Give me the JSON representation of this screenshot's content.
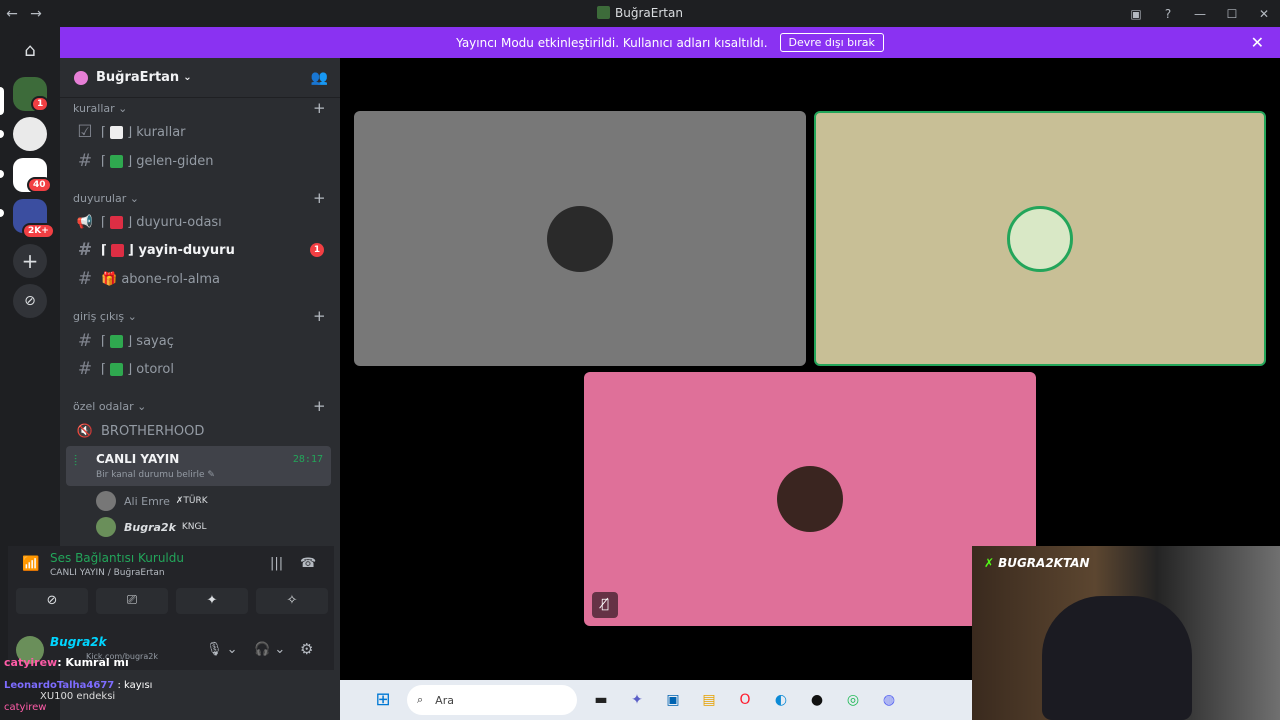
{
  "window": {
    "title": "BuğraErtan",
    "back": "←",
    "forward": "→",
    "controls": [
      "▣",
      "?",
      "—",
      "☐",
      "✕"
    ]
  },
  "banner": {
    "text": "Yayıncı Modu etkinleştirildi. Kullanıcı adları kısaltıldı.",
    "button": "Devre dışı bırak",
    "close": "✕"
  },
  "guilds": {
    "badges": [
      "1",
      "40",
      "2K+"
    ],
    "add": "+",
    "explore": "⊘"
  },
  "server": {
    "name": "BuğraErtan",
    "caret": "⌄",
    "invite_icon": "👥"
  },
  "categories": [
    {
      "name": "kurallar ⌄",
      "plus": "+"
    },
    {
      "name": "duyurular ⌄",
      "plus": "+"
    },
    {
      "name": "giriş çıkış ⌄",
      "plus": "+"
    },
    {
      "name": "özel odalar ⌄",
      "plus": "+"
    }
  ],
  "channels": [
    {
      "icon": "☑",
      "pre": "⌈",
      "post": "⌋",
      "name": "kurallar"
    },
    {
      "icon": "#",
      "pre": "⌈",
      "post": "⌋",
      "name": "gelen-giden"
    },
    {
      "icon": "📢",
      "pre": "⌈",
      "post": "⌋",
      "name": "duyuru-odası"
    },
    {
      "icon": "#",
      "pre": "⌈",
      "post": "⌋",
      "name": "yayin-duyuru",
      "unread": "1"
    },
    {
      "icon": "#",
      "pre": "",
      "post": "",
      "name": "🎁 abone-rol-alma"
    },
    {
      "icon": "#",
      "pre": "⌈",
      "post": "⌋",
      "name": "sayaç"
    },
    {
      "icon": "#",
      "pre": "⌈",
      "post": "⌋",
      "name": "otorol"
    },
    {
      "icon": "🔇",
      "pre": "",
      "post": "",
      "name": "BROTHERHOOD"
    }
  ],
  "voice_channel": {
    "icon": "⦙",
    "name": "CANLI YAYIN",
    "time": "28:17",
    "status": "Bir kanal durumu belirle ✎",
    "users": [
      {
        "name": "Ali Emre",
        "tag": "✗TÜRK"
      },
      {
        "name": "Bugra2k",
        "tag": "KNGL"
      }
    ]
  },
  "rtc": {
    "status": "Ses Bağlantısı Kuruldu",
    "sub": "CANLI YAYIN / BuğraErtan",
    "signal": "📶",
    "wave": "|||",
    "hangup": "☎",
    "actions": [
      "⊘",
      "⎚",
      "✦",
      "✧"
    ]
  },
  "user": {
    "name": "Bugra2k",
    "status": "Kick.com/bugra2k",
    "mic": "🎙 ⌄",
    "headset": "🎧 ⌄",
    "settings": "⚙"
  },
  "chat_overlay": {
    "user1": "catyirew",
    "msg1": ": Kumral mı",
    "user2": "LeonardoTalha4677",
    "msg2": ": kayısı",
    "line2b": "XU100 endeksi",
    "user3": "catyirew"
  },
  "tiles": {
    "mute": "🎙̸"
  },
  "webcam": {
    "brand": "BUGRA2KTAN",
    "logo": "✗"
  },
  "taskbar": {
    "start": "⊞",
    "search_icon": "⌕",
    "search_placeholder": "Ara",
    "apps": [
      "▬",
      "✦",
      "▣",
      "▤",
      "◉",
      "O",
      "◐",
      "●",
      "◎",
      "◍"
    ]
  }
}
